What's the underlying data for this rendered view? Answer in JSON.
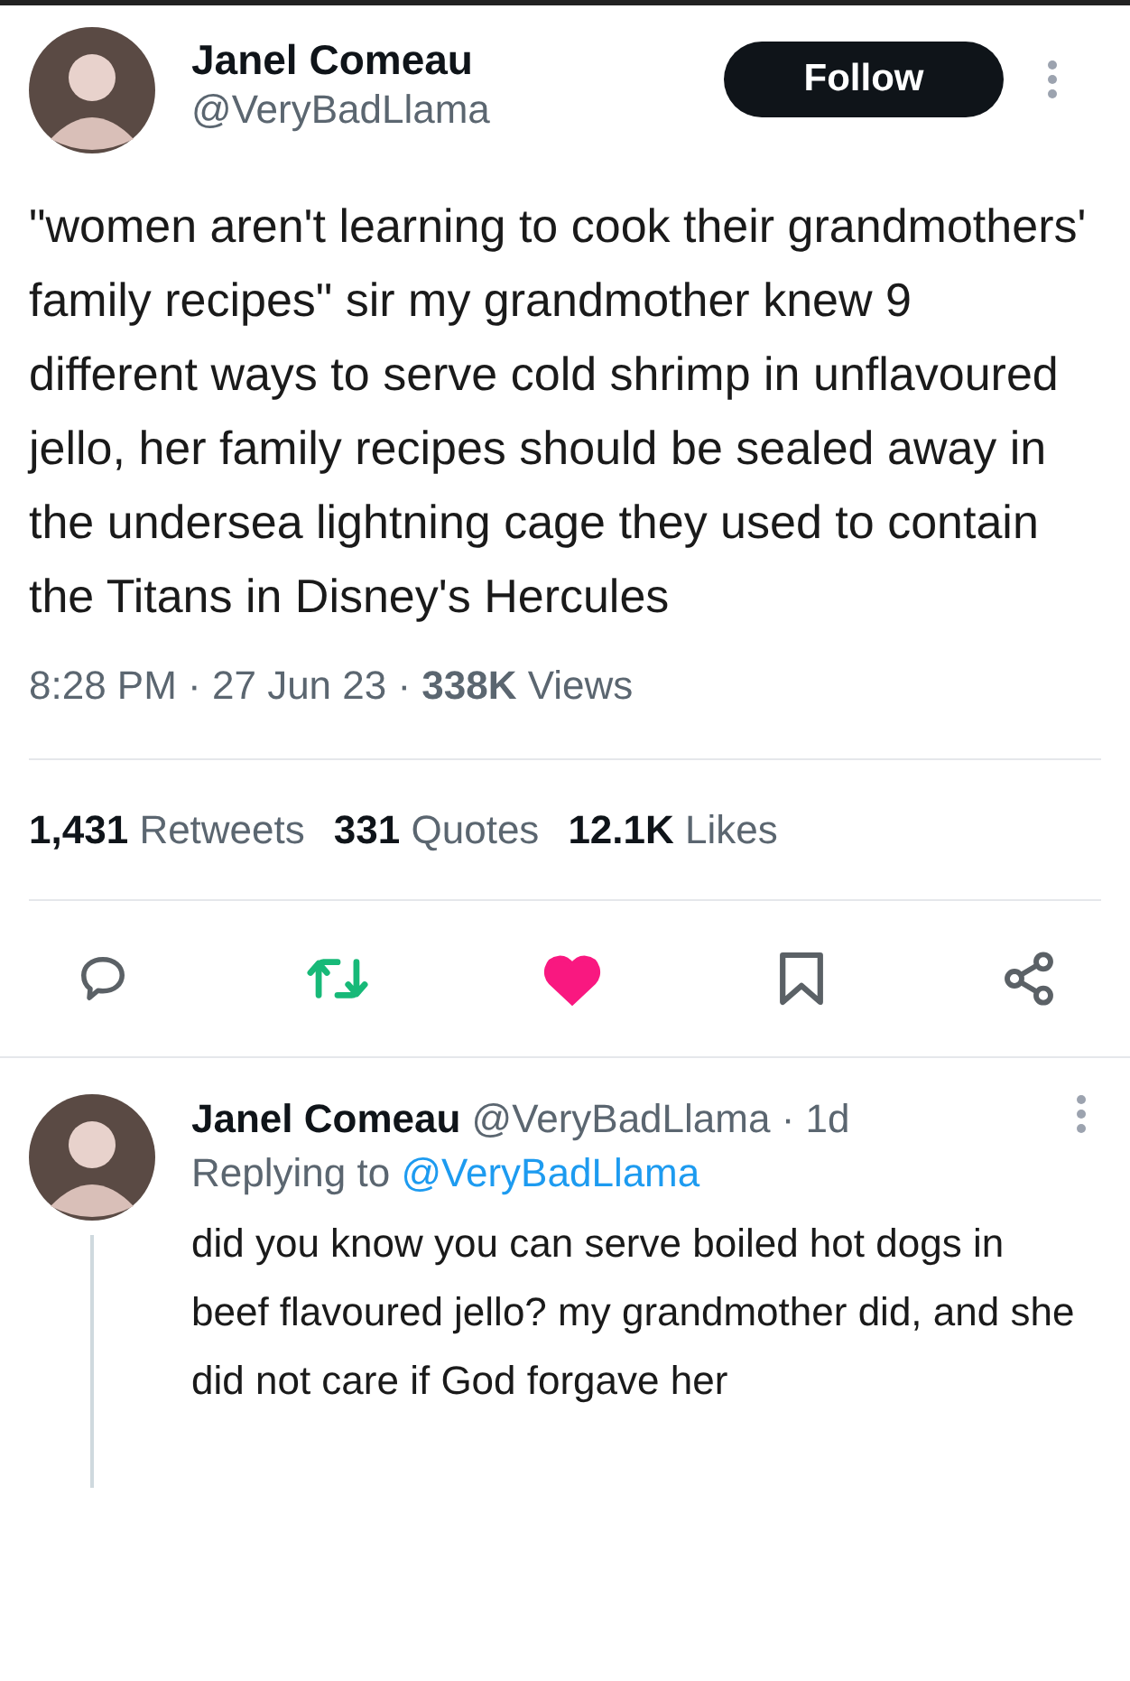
{
  "tweet": {
    "author": {
      "name": "Janel Comeau",
      "handle": "@VeryBadLlama"
    },
    "follow_button": "Follow",
    "text": "\"women aren't learning to cook their grandmothers' family recipes\" sir my grandmother knew 9 different ways to serve cold shrimp in unflavoured jello, her family recipes should be sealed away in the undersea lightning cage they used to contain the Titans in Disney's Hercules",
    "meta": "8:28 PM · 27 Jun 23 · **338K** Views",
    "stats": [
      {
        "count": "1,431",
        "label": "Retweets"
      },
      {
        "count": "331",
        "label": "Quotes"
      },
      {
        "count": "12.1K",
        "label": "Likes"
      }
    ],
    "actions": [
      {
        "kind": "reply",
        "active": false
      },
      {
        "kind": "retweet",
        "active": true
      },
      {
        "kind": "like",
        "active": true
      },
      {
        "kind": "bookmark",
        "active": false
      },
      {
        "kind": "share",
        "active": false
      }
    ]
  },
  "reply": {
    "author": {
      "name": "Janel Comeau",
      "handle": "@VeryBadLlama",
      "time": "· 1d"
    },
    "replying_label": "Replying to",
    "replying_handle": "@VeryBadLlama",
    "text": "did you know you can serve boiled hot dogs in beef flavoured jello? my grandmother did, and she did not care if God forgave her"
  }
}
